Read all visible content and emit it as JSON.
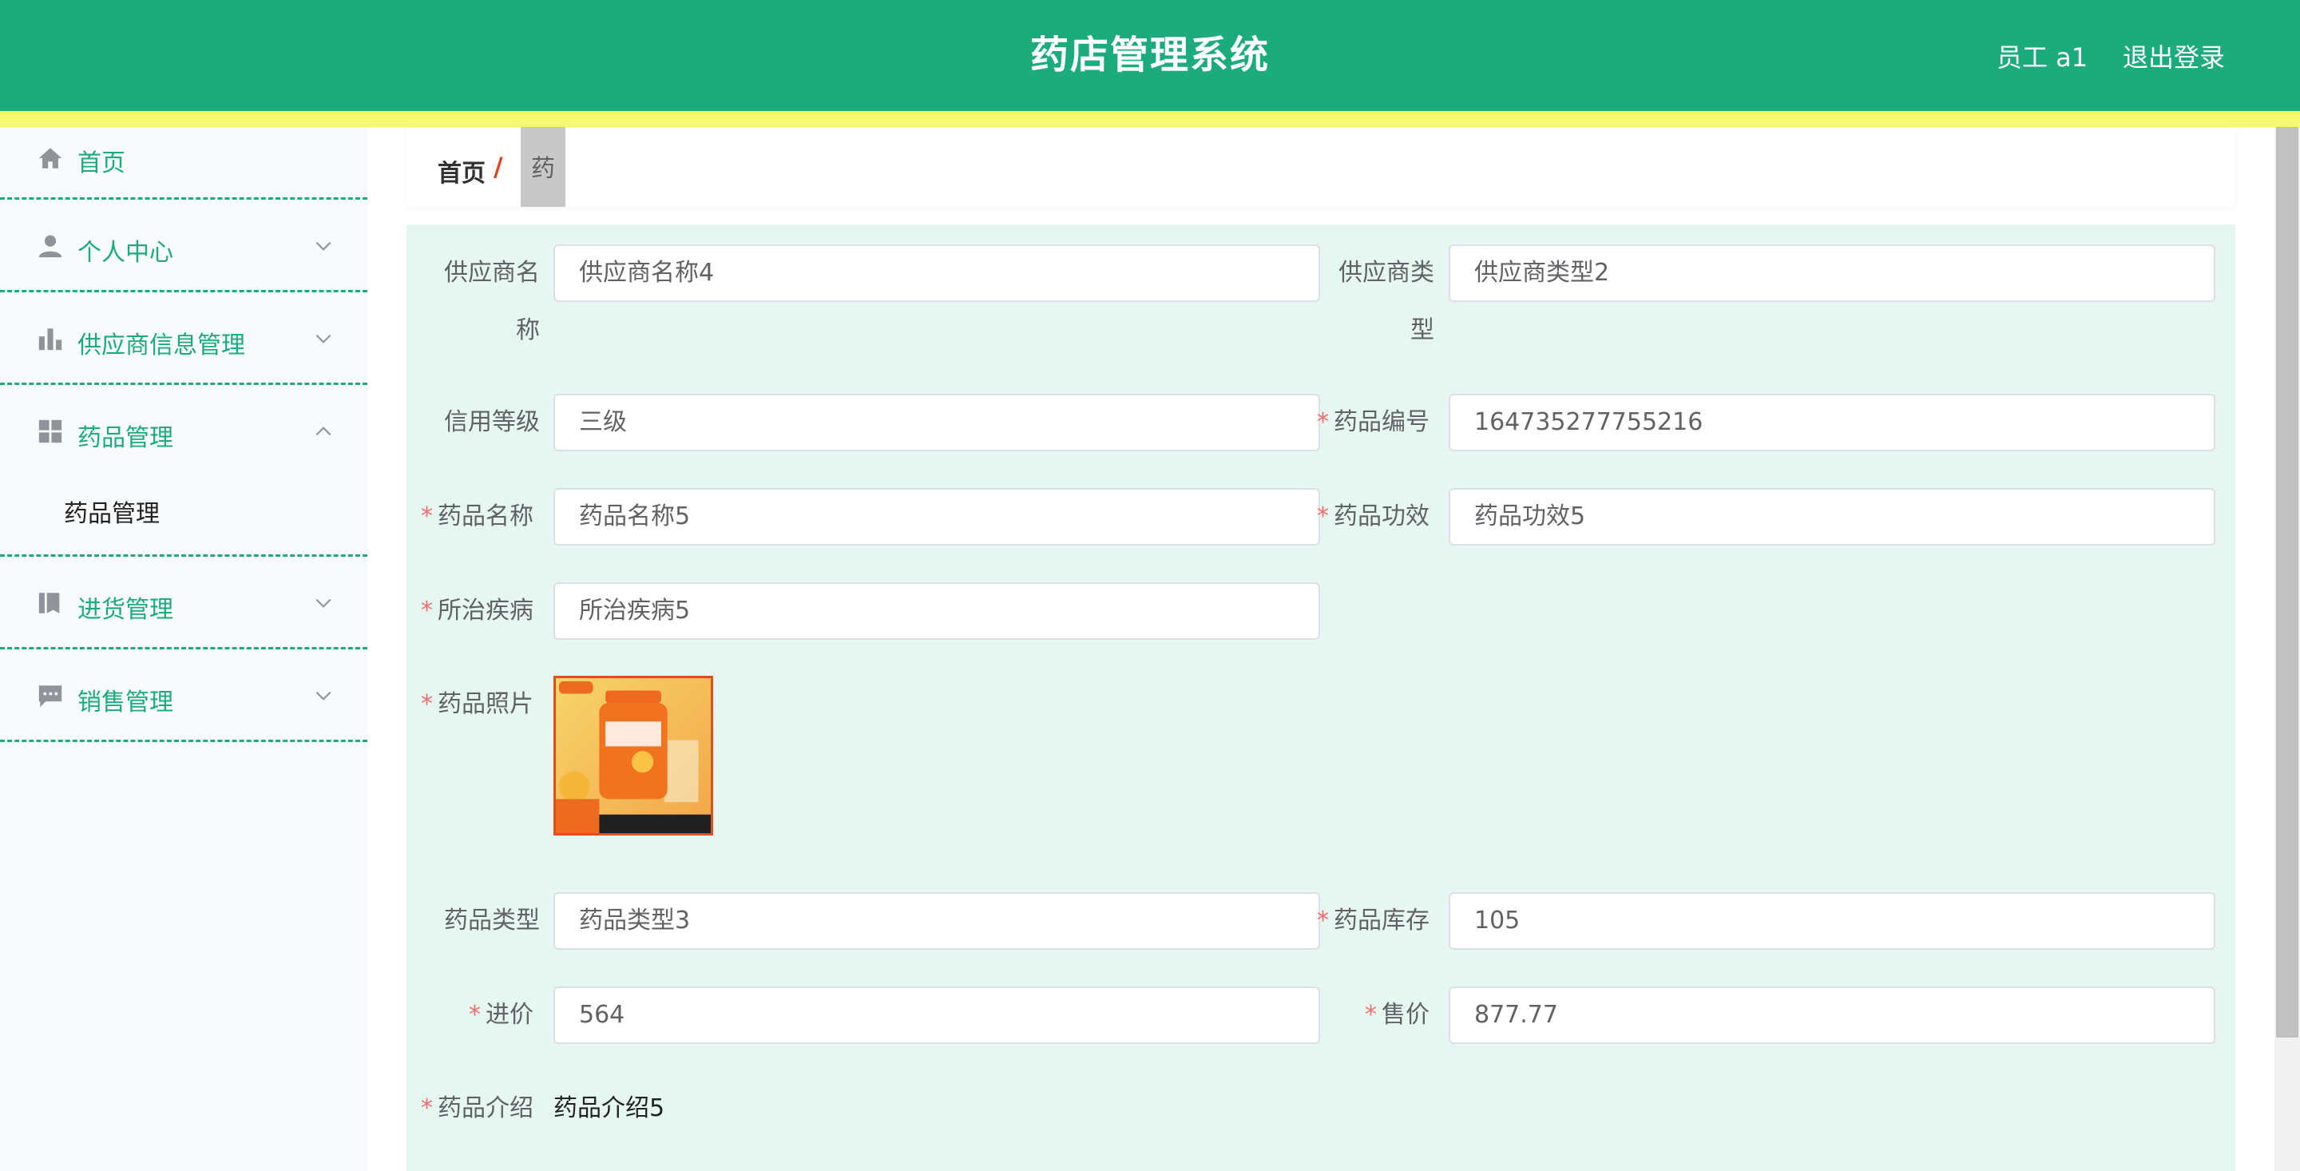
{
  "header": {
    "title": "药店管理系统",
    "user": "员工 a1",
    "logout": "退出登录"
  },
  "sidebar": {
    "items": [
      {
        "label": "首页",
        "icon": "home-icon"
      },
      {
        "label": "个人中心",
        "icon": "user-icon"
      },
      {
        "label": "供应商信息管理",
        "icon": "bar-chart-icon"
      },
      {
        "label": "药品管理",
        "icon": "grid-icon",
        "expanded": true,
        "children": [
          {
            "label": "药品管理"
          }
        ]
      },
      {
        "label": "进货管理",
        "icon": "book-icon"
      },
      {
        "label": "销售管理",
        "icon": "message-icon"
      }
    ]
  },
  "breadcrumb": {
    "home": "首页",
    "separator": "/",
    "current": "药品"
  },
  "form": {
    "supplier_name": {
      "label_line1": "供应商名",
      "label_line2": "称",
      "value": "供应商名称4"
    },
    "supplier_type": {
      "label_line1": "供应商类",
      "label_line2": "型",
      "value": "供应商类型2"
    },
    "credit_level": {
      "label": "信用等级",
      "value": "三级"
    },
    "drug_code": {
      "label": "药品编号",
      "value": "164735277755216",
      "required": true
    },
    "drug_name": {
      "label": "药品名称",
      "value": "药品名称5",
      "required": true
    },
    "drug_effect": {
      "label": "药品功效",
      "value": "药品功效5",
      "required": true
    },
    "disease": {
      "label": "所治疾病",
      "value": "所治疾病5",
      "required": true
    },
    "photo": {
      "label": "药品照片",
      "required": true
    },
    "drug_type": {
      "label": "药品类型",
      "value": "药品类型3"
    },
    "stock": {
      "label": "药品库存",
      "value": "105",
      "required": true
    },
    "purchase_price": {
      "label": "进价",
      "value": "564",
      "required": true
    },
    "sale_price": {
      "label": "售价",
      "value": "877.77",
      "required": true
    },
    "intro": {
      "label": "药品介绍",
      "value": "药品介绍5",
      "required": true
    },
    "required_mark": "*"
  },
  "colors": {
    "primary": "#1cac7c",
    "accent_bar": "#f6fa6e",
    "panel_bg": "#e6f6f0",
    "required": "#f56c6c",
    "breadcrumb_sep": "#e2461f"
  }
}
